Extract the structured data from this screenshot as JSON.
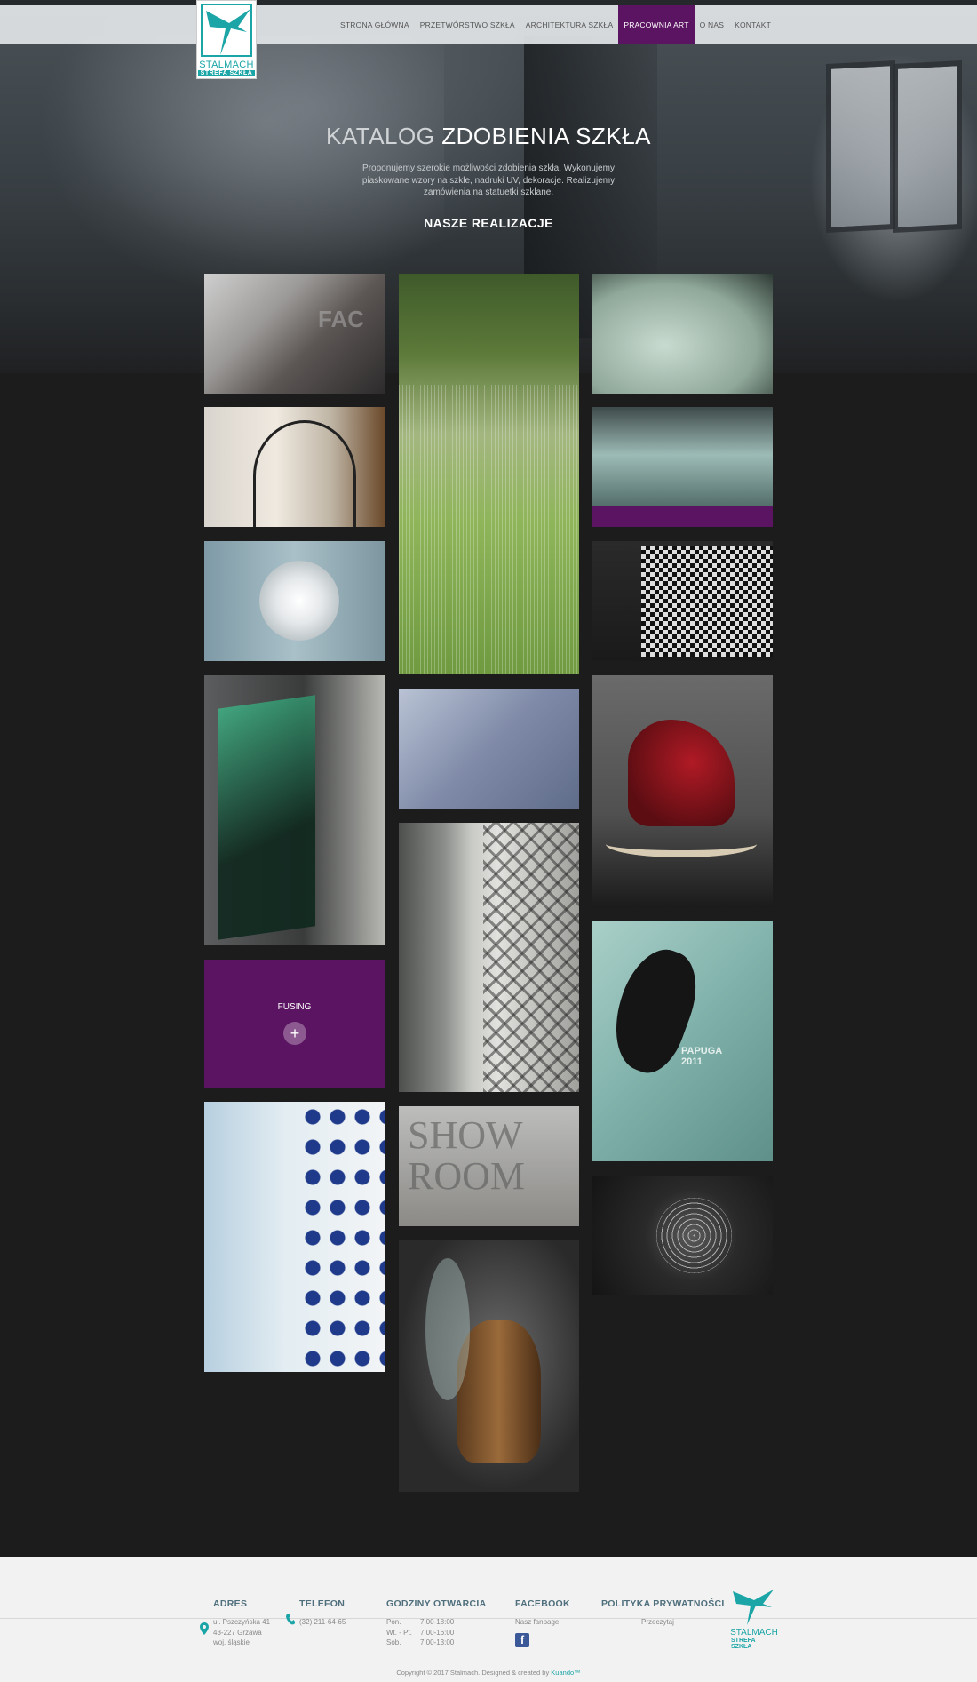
{
  "colors": {
    "accent": "#5b1461",
    "brand_teal": "#1ba5a6",
    "footer_heading": "#4f6f7c"
  },
  "logo": {
    "brand": "STALMACH",
    "sub": "STREFA SZKŁA",
    "icon": "bow-icon"
  },
  "nav": {
    "items": [
      {
        "label": "STRONA GŁÓWNA"
      },
      {
        "label": "PRZETWÓRSTWO SZKŁA"
      },
      {
        "label": "ARCHITEKTURA SZKŁA"
      },
      {
        "label": "PRACOWNIA ART",
        "active": true
      },
      {
        "label": "O NAS"
      },
      {
        "label": "KONTAKT"
      }
    ]
  },
  "hero": {
    "title_light": "KATALOG",
    "title_bold": "ZDOBIENIA SZKŁA",
    "description": "Proponujemy szerokie możliwości zdobienia szkła. Wykonujemy piaskowane wzory na szkle, nadruki UV, dekoracje. Realizujemy zamówienia na statuetki szklane.",
    "subtitle": "NASZE REALIZACJE"
  },
  "gallery": {
    "hover_label": "FUSING",
    "plus_symbol": "+"
  },
  "footer": {
    "address": {
      "heading": "ADRES",
      "line1": "ul. Pszczyńska 41",
      "line2": "43-227 Grzawa",
      "line3": "woj. śląskie"
    },
    "phone": {
      "heading": "TELEFON",
      "number": "(32) 211-64-65"
    },
    "hours": {
      "heading": "GODZINY OTWARCIA",
      "rows": [
        {
          "day": "Pon.",
          "time": "7:00-18:00"
        },
        {
          "day": "Wt. - Pt.",
          "time": "7:00-16:00"
        },
        {
          "day": "Sob.",
          "time": "7:00-13:00"
        }
      ]
    },
    "facebook": {
      "heading": "FACEBOOK",
      "text": "Nasz fanpage",
      "icon_letter": "f"
    },
    "privacy": {
      "heading": "POLITYKA PRYWATNOŚCI",
      "link": "Przeczytaj"
    },
    "logo_brand": "STALMACH",
    "logo_sub": "STREFA SZKŁA",
    "copyright": "Copyright © 2017 Stalmach. Designed & created by",
    "credit": "Kuando™"
  }
}
